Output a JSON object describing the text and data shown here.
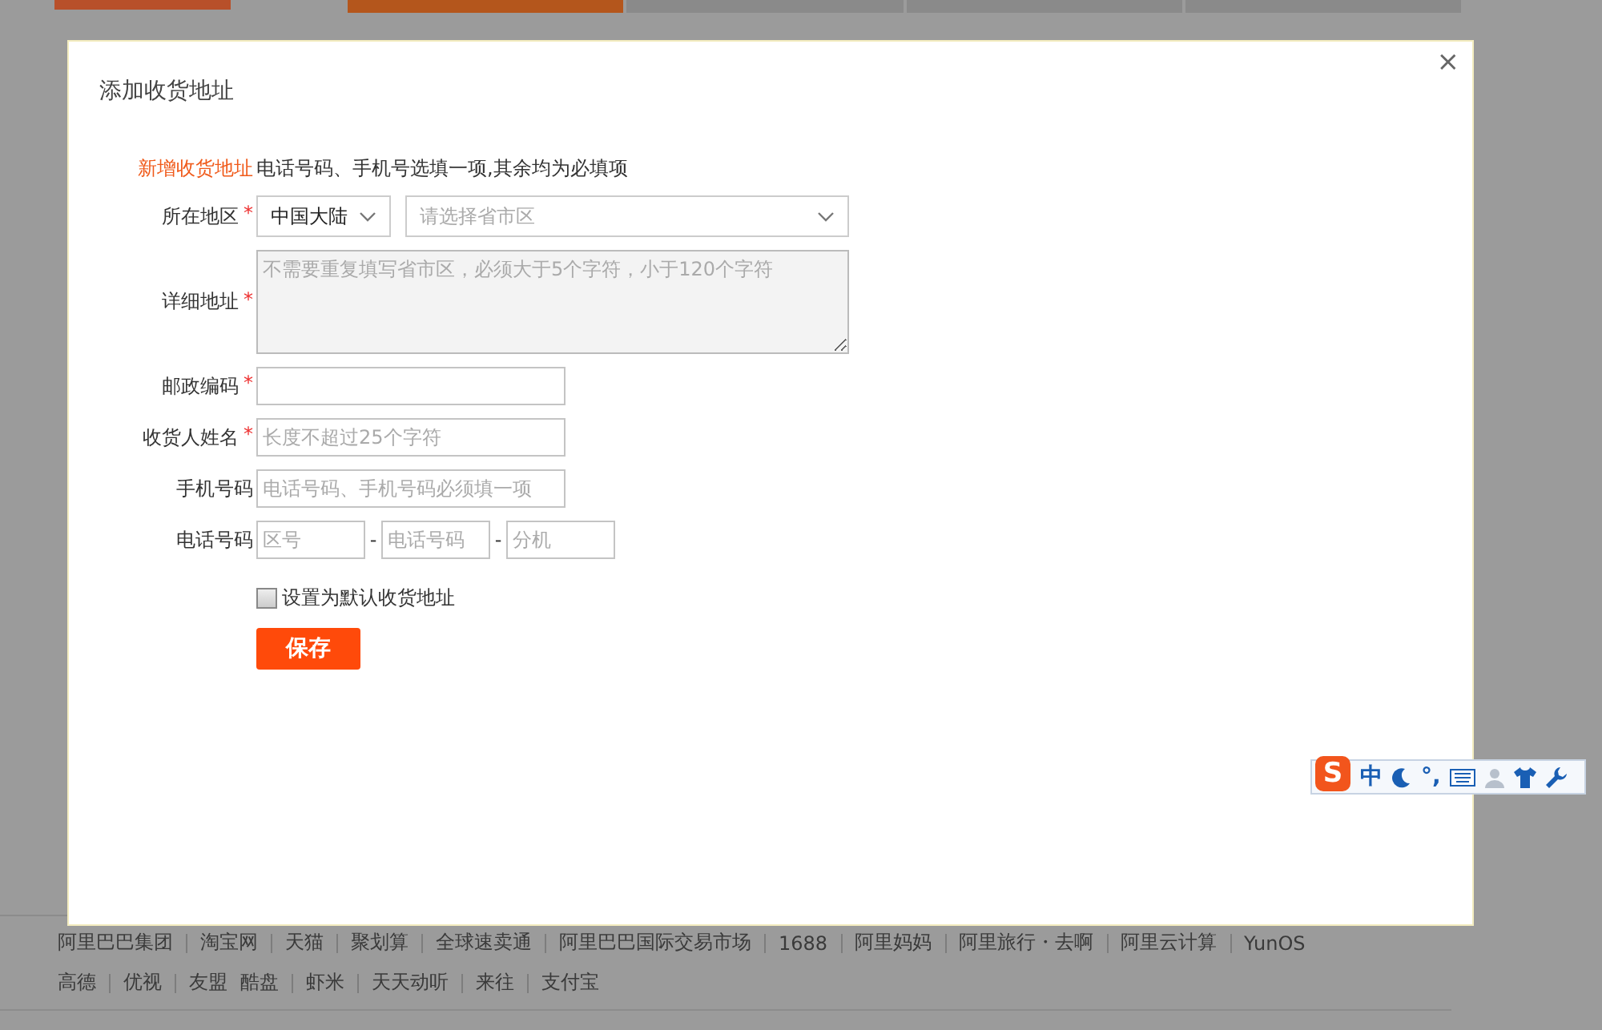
{
  "steps": [
    {
      "selected": true
    },
    {
      "selected": false
    },
    {
      "selected": false
    },
    {
      "selected": false
    }
  ],
  "dialog": {
    "title": "添加收货地址",
    "close": "×",
    "section_label": "新增收货地址",
    "note": "电话号码、手机号选填一项,其余均为必填项",
    "required_mark": "*",
    "fields": [
      {
        "kind": "region",
        "label": "所在地区",
        "required": true,
        "value": "中国大陆",
        "placeholder": "请选择省市区"
      },
      {
        "kind": "textarea",
        "label": "详细地址",
        "required": true,
        "placeholder": "不需要重复填写省市区，必须大于5个字符，小于120个字符"
      },
      {
        "kind": "text",
        "label": "邮政编码",
        "required": true
      },
      {
        "kind": "text",
        "label": "收货人姓名",
        "required": true,
        "placeholder": "长度不超过25个字符"
      },
      {
        "kind": "text",
        "label": "手机号码",
        "required": false,
        "placeholder": "电话号码、手机号码必须填一项"
      },
      {
        "kind": "phone",
        "label": "电话号码",
        "required": false,
        "parts": [
          {
            "placeholder": "区号"
          },
          {
            "placeholder": "电话号码"
          },
          {
            "placeholder": "分机"
          }
        ],
        "separator": "-"
      }
    ],
    "default_checkbox": {
      "label": "设置为默认收货地址",
      "checked": false
    },
    "save_button": "保存"
  },
  "footer": {
    "lines": [
      {
        "links": [
          {
            "text": "阿里巴巴集团",
            "divider_before": false
          },
          {
            "text": "淘宝网",
            "divider_before": true
          },
          {
            "text": "天猫",
            "divider_before": true
          },
          {
            "text": "聚划算",
            "divider_before": true
          },
          {
            "text": "全球速卖通",
            "divider_before": true
          },
          {
            "text": "阿里巴巴国际交易市场",
            "divider_before": true
          },
          {
            "text": "1688",
            "divider_before": true
          },
          {
            "text": "阿里妈妈",
            "divider_before": true
          },
          {
            "text": "阿里旅行・去啊",
            "divider_before": true
          },
          {
            "text": "阿里云计算",
            "divider_before": true
          },
          {
            "text": "YunOS",
            "divider_before": true
          }
        ]
      },
      {
        "links": [
          {
            "text": "高德",
            "divider_before": false
          },
          {
            "text": "优视",
            "divider_before": true
          },
          {
            "text": "友盟",
            "divider_before": true
          },
          {
            "text": "酷盘",
            "divider_before": false
          },
          {
            "text": "虾米",
            "divider_before": true
          },
          {
            "text": "天天动听",
            "divider_before": true
          },
          {
            "text": "来往",
            "divider_before": true
          },
          {
            "text": "支付宝",
            "divider_before": true
          }
        ]
      }
    ]
  },
  "ime_toolbar": {
    "logo": "S",
    "mode": "中",
    "punctuation": "°,"
  }
}
